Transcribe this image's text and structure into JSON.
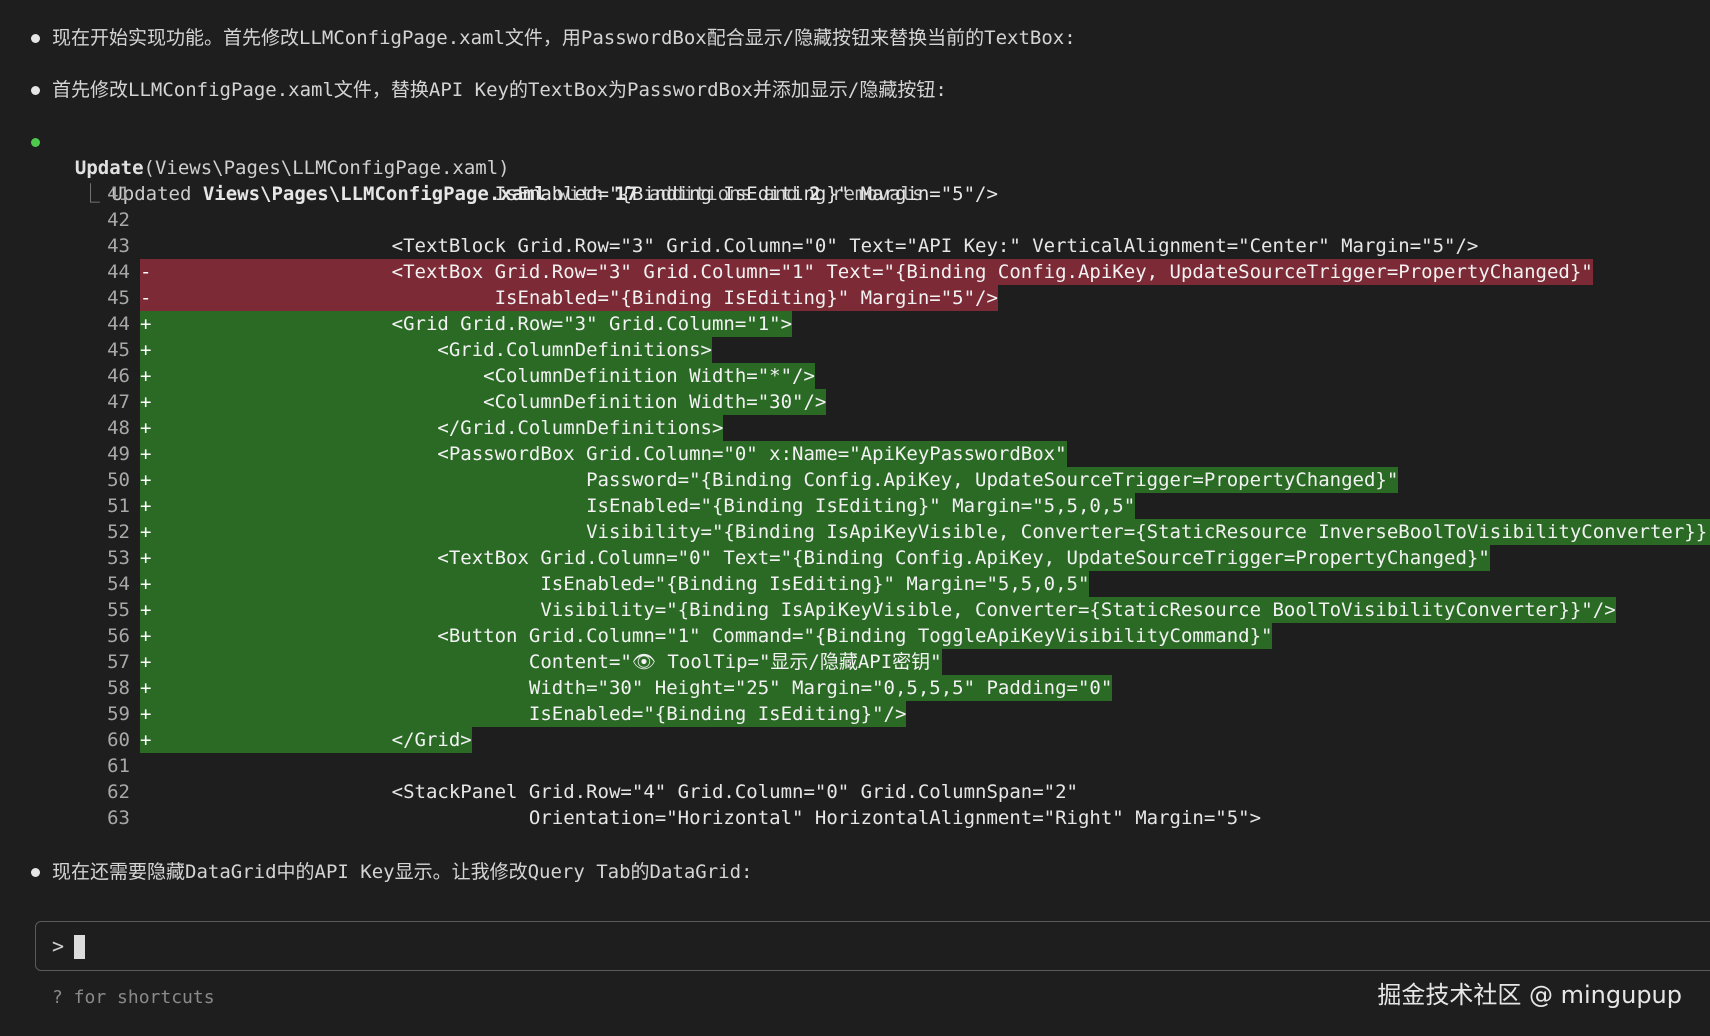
{
  "messages": [
    {
      "text": "现在开始实现功能。首先修改LLMConfigPage.xaml文件，用PasswordBox配合显示/隐藏按钮来替换当前的TextBox:"
    },
    {
      "text": "首先修改LLMConfigPage.xaml文件，替换API Key的TextBox为PasswordBox并添加显示/隐藏按钮:"
    }
  ],
  "tool_call": {
    "name": "Update",
    "args": "(Views\\Pages\\LLMConfigPage.xaml)",
    "summary_prefix": "Updated ",
    "summary_file": "Views\\Pages\\LLMConfigPage.xaml",
    "summary_with": " with ",
    "additions_count": "17",
    "summary_additions": " additions and ",
    "removals_count": "2",
    "summary_removals": " removals",
    "status_color": "#4ec94e"
  },
  "diff": [
    {
      "num": "41",
      "sign": " ",
      "type": "ctx",
      "code": "                             IsEnabled=\"{Binding IsEditing}\" Margin=\"5\"/>"
    },
    {
      "num": "42",
      "sign": " ",
      "type": "ctx",
      "code": ""
    },
    {
      "num": "43",
      "sign": " ",
      "type": "ctx",
      "code": "                    <TextBlock Grid.Row=\"3\" Grid.Column=\"0\" Text=\"API Key:\" VerticalAlignment=\"Center\" Margin=\"5\"/>"
    },
    {
      "num": "44",
      "sign": "-",
      "type": "del",
      "code": "                    <TextBox Grid.Row=\"3\" Grid.Column=\"1\" Text=\"{Binding Config.ApiKey, UpdateSourceTrigger=PropertyChanged}\""
    },
    {
      "num": "45",
      "sign": "-",
      "type": "del",
      "code": "                             IsEnabled=\"{Binding IsEditing}\" Margin=\"5\"/>"
    },
    {
      "num": "44",
      "sign": "+",
      "type": "add",
      "code": "                    <Grid Grid.Row=\"3\" Grid.Column=\"1\">"
    },
    {
      "num": "45",
      "sign": "+",
      "type": "add",
      "code": "                        <Grid.ColumnDefinitions>"
    },
    {
      "num": "46",
      "sign": "+",
      "type": "add",
      "code": "                            <ColumnDefinition Width=\"*\"/>"
    },
    {
      "num": "47",
      "sign": "+",
      "type": "add",
      "code": "                            <ColumnDefinition Width=\"30\"/>"
    },
    {
      "num": "48",
      "sign": "+",
      "type": "add",
      "code": "                        </Grid.ColumnDefinitions>"
    },
    {
      "num": "49",
      "sign": "+",
      "type": "add",
      "code": "                        <PasswordBox Grid.Column=\"0\" x:Name=\"ApiKeyPasswordBox\""
    },
    {
      "num": "50",
      "sign": "+",
      "type": "add",
      "code": "                                     Password=\"{Binding Config.ApiKey, UpdateSourceTrigger=PropertyChanged}\""
    },
    {
      "num": "51",
      "sign": "+",
      "type": "add",
      "code": "                                     IsEnabled=\"{Binding IsEditing}\" Margin=\"5,5,0,5\""
    },
    {
      "num": "52",
      "sign": "+",
      "type": "add",
      "code": "                                     Visibility=\"{Binding IsApiKeyVisible, Converter={StaticResource InverseBoolToVisibilityConverter}}\"/>"
    },
    {
      "num": "53",
      "sign": "+",
      "type": "add",
      "code": "                        <TextBox Grid.Column=\"0\" Text=\"{Binding Config.ApiKey, UpdateSourceTrigger=PropertyChanged}\""
    },
    {
      "num": "54",
      "sign": "+",
      "type": "add",
      "code": "                                 IsEnabled=\"{Binding IsEditing}\" Margin=\"5,5,0,5\""
    },
    {
      "num": "55",
      "sign": "+",
      "type": "add",
      "code": "                                 Visibility=\"{Binding IsApiKeyVisible, Converter={StaticResource BoolToVisibilityConverter}}\"/>"
    },
    {
      "num": "56",
      "sign": "+",
      "type": "add",
      "code": "                        <Button Grid.Column=\"1\" Command=\"{Binding ToggleApiKeyVisibilityCommand}\""
    },
    {
      "num": "57",
      "sign": "+",
      "type": "add",
      "code": "                                Content=\"👁 ToolTip=\"显示/隐藏API密钥\""
    },
    {
      "num": "58",
      "sign": "+",
      "type": "add",
      "code": "                                Width=\"30\" Height=\"25\" Margin=\"0,5,5,5\" Padding=\"0\""
    },
    {
      "num": "59",
      "sign": "+",
      "type": "add",
      "code": "                                IsEnabled=\"{Binding IsEditing}\"/>"
    },
    {
      "num": "60",
      "sign": "+",
      "type": "add",
      "code": "                    </Grid>"
    },
    {
      "num": "61",
      "sign": " ",
      "type": "ctx",
      "code": ""
    },
    {
      "num": "62",
      "sign": " ",
      "type": "ctx",
      "code": "                    <StackPanel Grid.Row=\"4\" Grid.Column=\"0\" Grid.ColumnSpan=\"2\""
    },
    {
      "num": "63",
      "sign": " ",
      "type": "ctx",
      "code": "                                Orientation=\"Horizontal\" HorizontalAlignment=\"Right\" Margin=\"5\">"
    }
  ],
  "after_message": {
    "text": "现在还需要隐藏DataGrid中的API Key显示。让我修改Query Tab的DataGrid:"
  },
  "input": {
    "prompt_char": ">",
    "hint": "? for shortcuts"
  },
  "watermark": "掘金技术社区 @ mingupup",
  "colors": {
    "removed_bg": "#7b2a36",
    "added_bg": "#2a6a25",
    "background": "#1e1e1e"
  }
}
